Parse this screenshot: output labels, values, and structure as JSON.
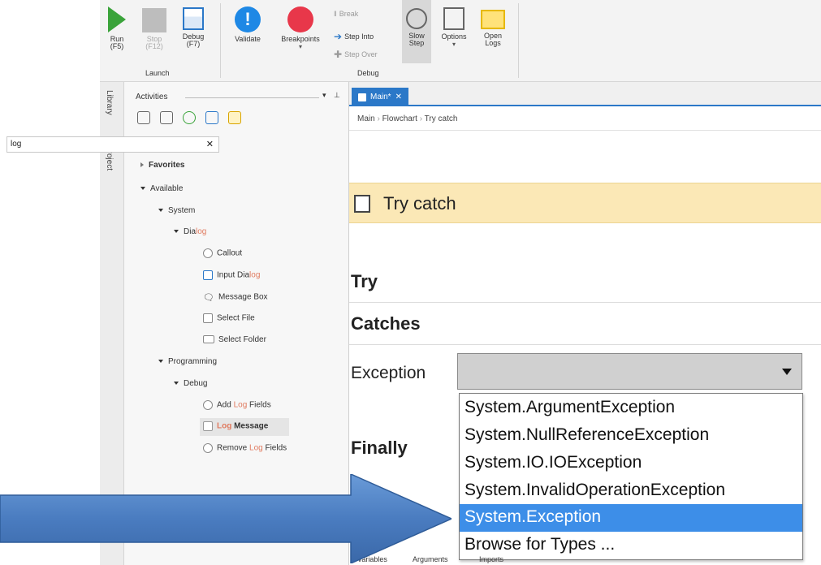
{
  "ribbon": {
    "run": "Run\n(F5)",
    "stop": "Stop\n(F12)",
    "debug": "Debug\n(F7)",
    "validate": "Validate",
    "breakpoints": "Breakpoints",
    "break": "Break",
    "step_into": "Step Into",
    "step_over": "Step Over",
    "slow_step": "Slow\nStep",
    "options": "Options",
    "open_logs": "Open\nLogs",
    "group_launch": "Launch",
    "group_debug": "Debug"
  },
  "vtabs": [
    "Library",
    "Project"
  ],
  "activities": {
    "title": "Activities",
    "search_value": "log",
    "tree": {
      "favorites": "Favorites",
      "available": "Available",
      "system": "System",
      "dialog_prefix": "Dia",
      "dialog_hl": "log",
      "callout": "Callout",
      "input_dialog_prefix": "Input Dia",
      "input_dialog_hl": "log",
      "message_box": "Message Box",
      "select_file": "Select File",
      "select_folder": "Select Folder",
      "programming": "Programming",
      "debug": "Debug",
      "add_prefix": "Add ",
      "add_hl": "Log",
      "add_suffix": " Fields",
      "log_hl": "Log",
      "log_suffix": " Message",
      "remove_prefix": "Remove ",
      "remove_hl": "Log",
      "remove_suffix": " Fields"
    }
  },
  "designer": {
    "tab": "Main*",
    "breadcrumb": [
      "Main",
      "Flowchart",
      "Try catch"
    ],
    "activity_title": "Try catch",
    "try_label": "Try",
    "catches_label": "Catches",
    "exception_label": "Exception",
    "finally_label": "Finally",
    "dropdown_options": [
      "System.ArgumentException",
      "System.NullReferenceException",
      "System.IO.IOException",
      "System.InvalidOperationException",
      "System.Exception",
      "Browse for Types ..."
    ],
    "selected_option": "System.Exception",
    "bottom_tabs": [
      "Variables",
      "Arguments",
      "Imports"
    ]
  },
  "colors": {
    "accent": "#2b78c8",
    "selection": "#3d8ee8",
    "try_catch_header": "#fbe8b6",
    "arrow_fill": "#4a7cc0",
    "run_green": "#3aa33a",
    "breakpoint_red": "#e8374a",
    "validate_blue": "#1e88e5"
  }
}
